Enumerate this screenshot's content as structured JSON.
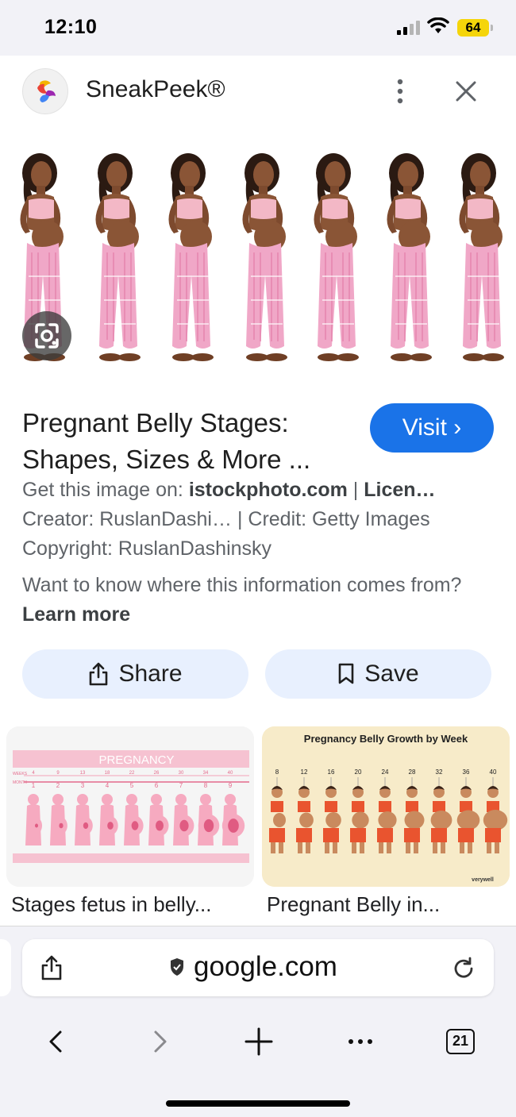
{
  "status": {
    "time": "12:10",
    "battery": "64"
  },
  "header": {
    "app_name": "SneakPeek®"
  },
  "result": {
    "title": "Pregnant Belly Stages: Shapes, Sizes & More ...",
    "visit_label": "Visit ›",
    "source_prefix": "Get this image on: ",
    "source_site": "istockphoto.com",
    "source_sep": " | ",
    "license": "Licen…",
    "creator": "Creator: RuslanDashi…",
    "credit": " | Credit: Getty Images",
    "copyright": "Copyright: RuslanDashinsky",
    "info_text": "Want to know where this information comes from? ",
    "learn_more": "Learn more"
  },
  "actions": {
    "share_label": "Share",
    "save_label": "Save"
  },
  "related": [
    {
      "caption": "Stages fetus in belly...",
      "banner": "PREGNANCY",
      "row_labels": [
        "WEEKS",
        "MONTH"
      ],
      "weeks": [
        "4",
        "9",
        "13",
        "18",
        "22",
        "26",
        "30",
        "34",
        "40"
      ],
      "months": [
        "1",
        "2",
        "3",
        "4",
        "5",
        "6",
        "7",
        "8",
        "9"
      ]
    },
    {
      "caption": "Pregnant Belly in...",
      "title": "Pregnancy Belly Growth by Week",
      "weeks": [
        "8",
        "12",
        "16",
        "20",
        "24",
        "28",
        "32",
        "36",
        "40"
      ],
      "watermark": "verywell"
    }
  ],
  "browser": {
    "url": "google.com",
    "tab_count": "21"
  },
  "colors": {
    "accent": "#1a73e8",
    "pill": "#e8f0fe",
    "chrome": "#f2f2f7",
    "battery": "#f5d50a"
  }
}
